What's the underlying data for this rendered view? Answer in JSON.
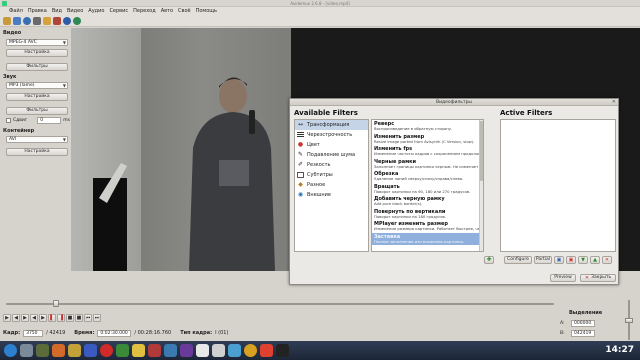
{
  "window": {
    "title": "Avidemux 2.6.8 - [video.mp4]"
  },
  "menu": [
    "Файл",
    "Правка",
    "Вид",
    "Видео",
    "Аудио",
    "Сервис",
    "Переход",
    "Авто",
    "Своё",
    "Помощь"
  ],
  "toolbar_icons": [
    "open-icon",
    "save-icon",
    "info-icon",
    "calc-icon",
    "python-icon",
    "js-icon",
    "preview-icon",
    "output-icon"
  ],
  "left_panel": {
    "video": {
      "title": "Видео",
      "codec": "MPEG-4 AVC",
      "configure": "Настройка",
      "filters": "Фильтры"
    },
    "audio": {
      "title": "Звук",
      "codec": "MP3 (lame)",
      "configure": "Настройка",
      "filters": "Фильтры",
      "shift_label": "Сдвиг",
      "shift_value": "0",
      "shift_unit": "ms"
    },
    "container": {
      "title": "Контейнер",
      "format": "AVI",
      "configure": "Настройка"
    }
  },
  "dialog": {
    "title": "Видеофильтры",
    "available_title": "Available Filters",
    "active_title": "Active Filters",
    "categories": [
      {
        "label": "Трансформация",
        "icon": "transform-icon",
        "selected": true
      },
      {
        "label": "Черезстрочность",
        "icon": "interlace-icon",
        "selected": false
      },
      {
        "label": "Цвет",
        "icon": "color-icon",
        "selected": false
      },
      {
        "label": "Подавление шума",
        "icon": "denoise-icon",
        "selected": false
      },
      {
        "label": "Резкость",
        "icon": "sharpness-icon",
        "selected": false
      },
      {
        "label": "Субтитры",
        "icon": "subtitles-icon",
        "selected": false
      },
      {
        "label": "Разное",
        "icon": "misc-icon",
        "selected": false
      },
      {
        "label": "Внешние",
        "icon": "external-icon",
        "selected": false
      }
    ],
    "filters": [
      {
        "name": "Реверс",
        "desc": "Воспроизведение в обратную сторону."
      },
      {
        "name": "Изменить размер",
        "desc": "Resize image ported from Avisynth (C Version, slow)."
      },
      {
        "name": "Изменить fps",
        "desc": "Изменение частоты кадров с сохранением продолжительности."
      },
      {
        "name": "Черные рамки",
        "desc": "Заполняет границы картинки черным. Не изменяет ее размер."
      },
      {
        "name": "Обрезка",
        "desc": "Удаление линий сверху/снизу/справа/слева."
      },
      {
        "name": "Вращать",
        "desc": "Поворот картинки на 90, 180 или 270 градусов."
      },
      {
        "name": "Добавить черную рамку",
        "desc": "Add pure black border(s)."
      },
      {
        "name": "Повернуть по вертикали",
        "desc": "Поворот картинки на 180 градусов."
      },
      {
        "name": "MPlayer изменить размер",
        "desc": "Изменение размера картинки. Работает быстрее, чем Avisynth."
      },
      {
        "name": "Заставка",
        "desc": "Полное заполнение изо вложения картинки.",
        "selected": true
      }
    ],
    "buttons": {
      "configure": "Configure",
      "partial": "Partial",
      "preview": "Preview",
      "close": "Закрыть"
    }
  },
  "playback": {
    "frame_label": "Кадр:",
    "frame_value": "3750",
    "frame_total": "/ 42419",
    "time_label": "Время:",
    "time_value": "0:02:30.000",
    "time_total": "/ 00:28:16.760",
    "frame_type_label": "Тип кадра:",
    "frame_type_value": "I (01)"
  },
  "selection": {
    "title": "Выделение",
    "a_label": "A:",
    "a_value": "000000",
    "b_label": "B:",
    "b_value": "042419"
  },
  "taskbar": {
    "clock": "14:27"
  },
  "colors": {
    "accent": "#c6d4e8",
    "selection": "#8fb0dc",
    "taskbar": "#25304a"
  }
}
